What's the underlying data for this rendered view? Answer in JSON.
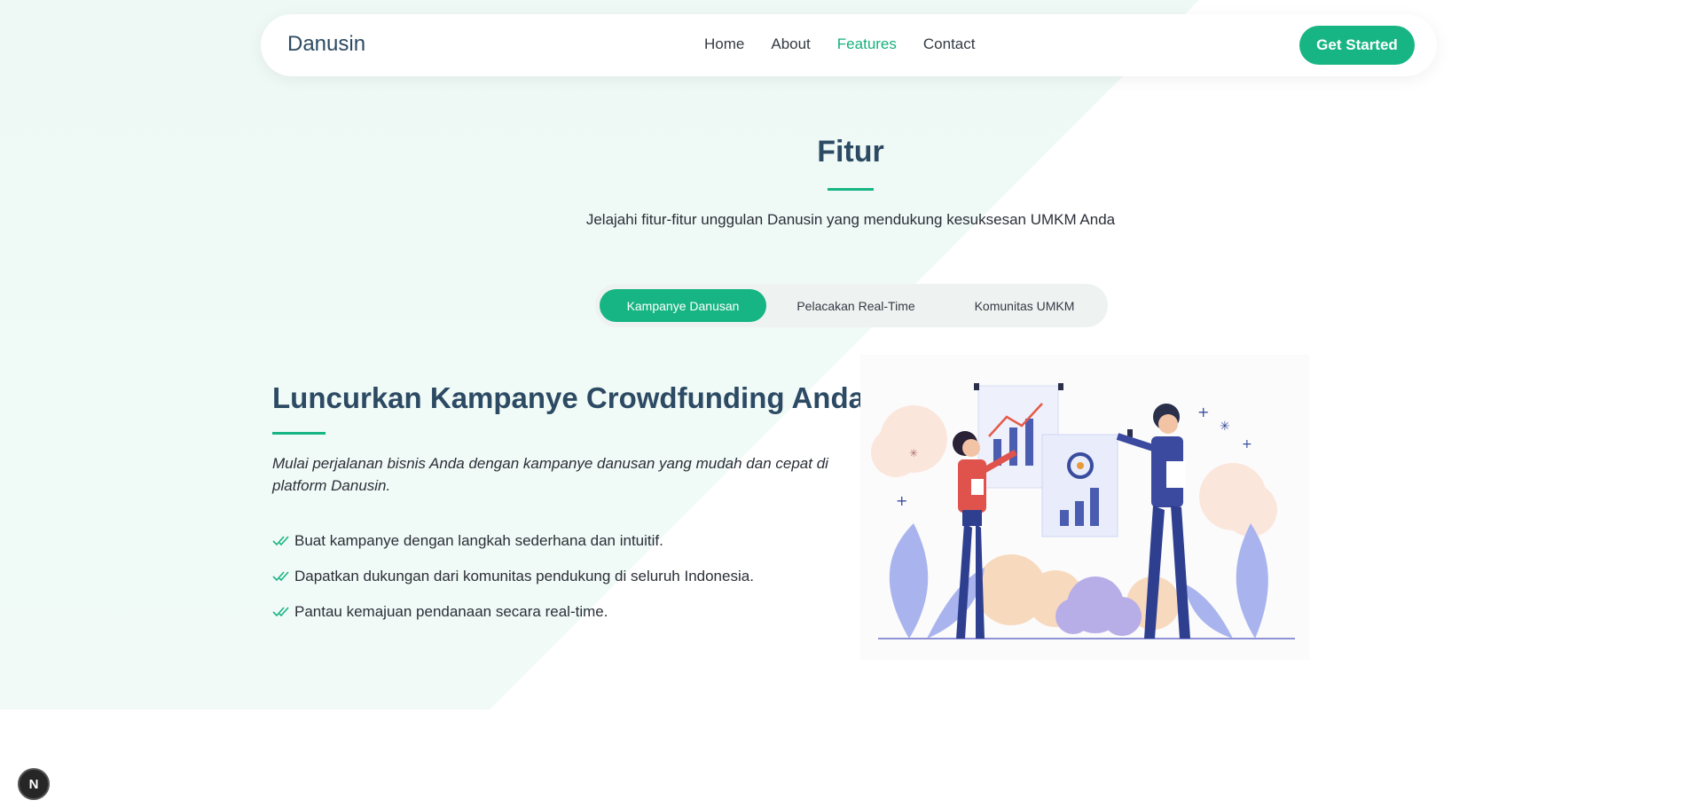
{
  "nav": {
    "brand": "Danusin",
    "links": [
      "Home",
      "About",
      "Features",
      "Contact"
    ],
    "active_link": "Features",
    "cta_label": "Get Started"
  },
  "section": {
    "title": "Fitur",
    "subtitle": "Jelajahi fitur-fitur unggulan Danusin yang mendukung kesuksesan UMKM Anda"
  },
  "tabs": [
    {
      "label": "Kampanye Danusan",
      "active": true
    },
    {
      "label": "Pelacakan Real-Time",
      "active": false
    },
    {
      "label": "Komunitas UMKM",
      "active": false
    }
  ],
  "content": {
    "title": "Luncurkan Kampanye Crowdfunding Anda",
    "description": "Mulai perjalanan bisnis Anda dengan kampanye danusan yang mudah dan cepat di platform Danusin.",
    "features": [
      "Buat kampanye dengan langkah sederhana dan intuitif.",
      "Dapatkan dukungan dari komunitas pendukung di seluruh Indonesia.",
      "Pantau kemajuan pendanaan secara real-time."
    ]
  },
  "badge": {
    "letter": "N"
  },
  "colors": {
    "accent": "#17b583",
    "heading": "#2c4a63",
    "background_band": "#eef9f5"
  },
  "icons": [
    "double-check-icon",
    "next-logo-icon"
  ]
}
